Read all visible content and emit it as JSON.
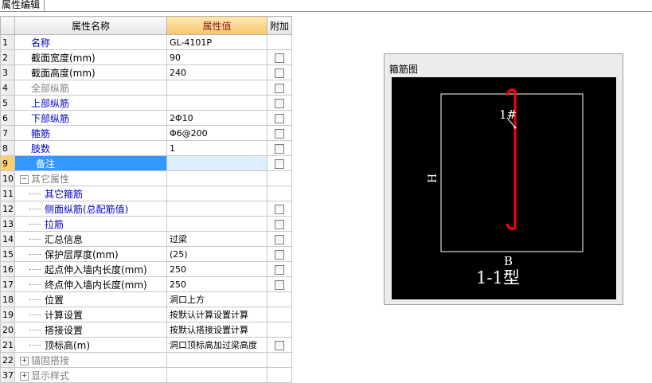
{
  "tab": {
    "label": "属性编辑"
  },
  "table": {
    "headers": {
      "num": "",
      "name": "属性名称",
      "value": "属性值",
      "extra": "附加"
    },
    "rows": [
      {
        "num": "1",
        "name": "名称",
        "value": "GL-4101P",
        "style": "blue",
        "check": false
      },
      {
        "num": "2",
        "name": "截面宽度(mm)",
        "value": "90",
        "style": "normal",
        "check": true
      },
      {
        "num": "3",
        "name": "截面高度(mm)",
        "value": "240",
        "style": "normal",
        "check": true
      },
      {
        "num": "4",
        "name": "全部纵筋",
        "value": "",
        "style": "gray",
        "check": true
      },
      {
        "num": "5",
        "name": "上部纵筋",
        "value": "",
        "style": "blue",
        "check": true
      },
      {
        "num": "6",
        "name": "下部纵筋",
        "value": "2Φ10",
        "style": "blue",
        "check": true
      },
      {
        "num": "7",
        "name": "箍筋",
        "value": "Φ6@200",
        "style": "blue",
        "check": true
      },
      {
        "num": "8",
        "name": "肢数",
        "value": "1",
        "style": "blue",
        "check": true
      },
      {
        "num": "9",
        "name": "备注",
        "value": "",
        "style": "selected",
        "check": true
      },
      {
        "num": "10",
        "name": "其它属性",
        "value": "",
        "style": "group-gray",
        "check": false
      },
      {
        "num": "11",
        "name": "其它箍筋",
        "value": "",
        "style": "child-blue",
        "check": false
      },
      {
        "num": "12",
        "name": "侧面纵筋(总配筋值)",
        "value": "",
        "style": "child-blue",
        "check": true
      },
      {
        "num": "13",
        "name": "拉筋",
        "value": "",
        "style": "child-blue",
        "check": true
      },
      {
        "num": "14",
        "name": "汇总信息",
        "value": "过梁",
        "style": "child",
        "check": true
      },
      {
        "num": "15",
        "name": "保护层厚度(mm)",
        "value": "(25)",
        "style": "child",
        "check": true
      },
      {
        "num": "16",
        "name": "起点伸入墙内长度(mm)",
        "value": "250",
        "style": "child",
        "check": true
      },
      {
        "num": "17",
        "name": "终点伸入墙内长度(mm)",
        "value": "250",
        "style": "child",
        "check": true
      },
      {
        "num": "18",
        "name": "位置",
        "value": "洞口上方",
        "style": "child",
        "check": false
      },
      {
        "num": "19",
        "name": "计算设置",
        "value": "按默认计算设置计算",
        "style": "child",
        "check": false
      },
      {
        "num": "20",
        "name": "搭接设置",
        "value": "按默认搭接设置计算",
        "style": "child",
        "check": false
      },
      {
        "num": "21",
        "name": "顶标高(m)",
        "value": "洞口顶标高加过梁高度",
        "style": "child",
        "check": true
      },
      {
        "num": "22",
        "name": "锚固搭接",
        "value": "",
        "style": "group-gray",
        "check": false
      },
      {
        "num": "37",
        "name": "显示样式",
        "value": "",
        "style": "group-gray",
        "check": false
      }
    ]
  },
  "diagram": {
    "title": "箍筋图",
    "bar_label": "1#",
    "height_label": "H",
    "width_label": "B",
    "section_label": "1-1型",
    "colors": {
      "background": "#000000",
      "outline": "#ffffff",
      "rebar": "#ff0000"
    }
  }
}
